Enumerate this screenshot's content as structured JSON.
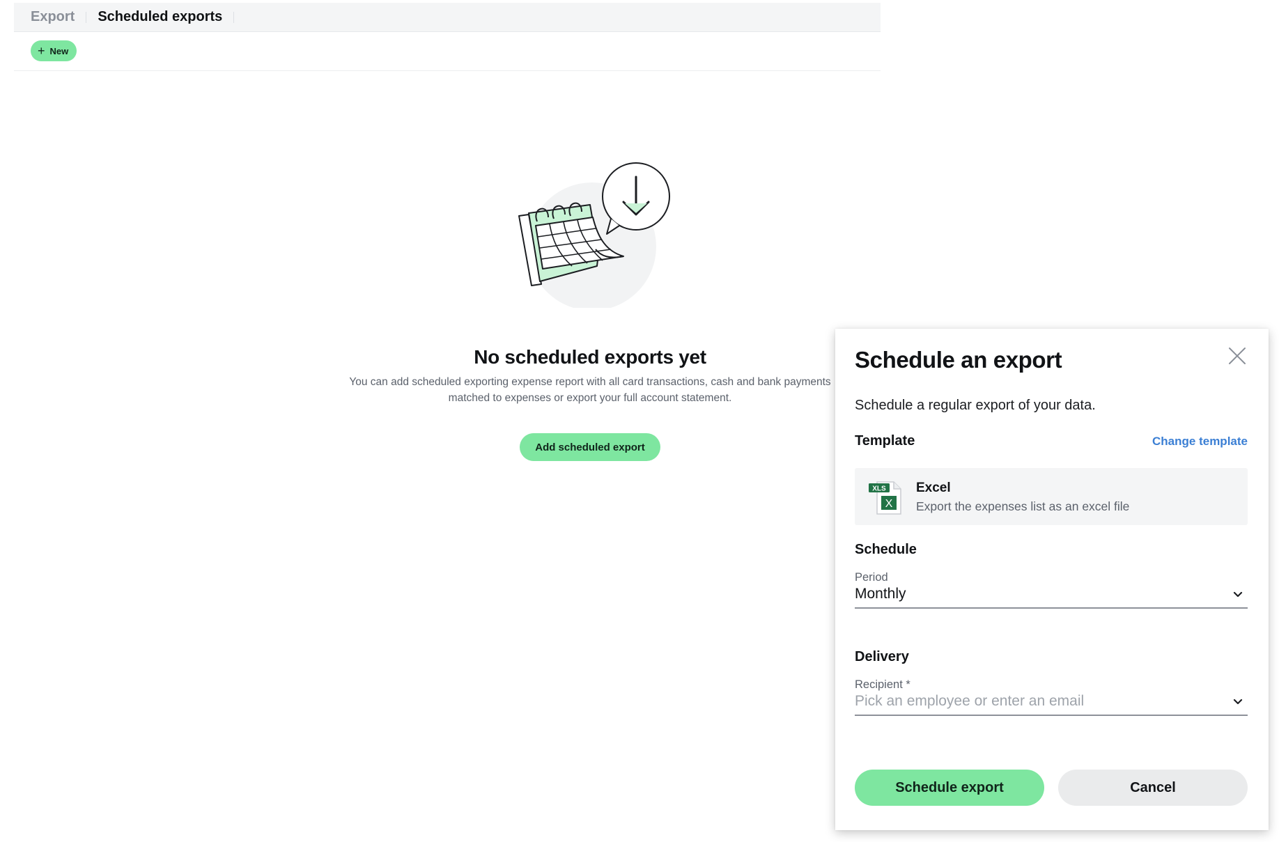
{
  "tabs": [
    {
      "label": "Export",
      "active": false
    },
    {
      "label": "Scheduled exports",
      "active": true
    }
  ],
  "toolbar": {
    "new_label": "New",
    "new_icon": "plus-icon"
  },
  "empty_state": {
    "illustration": "calendar-download-illustration",
    "title": "No scheduled exports yet",
    "description": "You can add scheduled exporting expense report with all card transactions, cash and bank payments matched to expenses or export your full account statement.",
    "button_label": "Add scheduled export"
  },
  "panel": {
    "title": "Schedule an export",
    "subtitle": "Schedule a regular export of your data.",
    "template_section": "Template",
    "change_template": "Change template",
    "template": {
      "icon": "xls-file-icon",
      "icon_badge": "XLS",
      "icon_letter": "X",
      "name": "Excel",
      "description": "Export the expenses list as an excel file"
    },
    "schedule_section": "Schedule",
    "period_label": "Period",
    "period_value": "Monthly",
    "delivery_section": "Delivery",
    "recipient_label": "Recipient *",
    "recipient_placeholder": "Pick an employee or enter an email",
    "primary_button": "Schedule export",
    "secondary_button": "Cancel"
  },
  "colors": {
    "accent_green": "#7ee6a0",
    "link_blue": "#3b7fd4",
    "excel_green": "#217346"
  }
}
